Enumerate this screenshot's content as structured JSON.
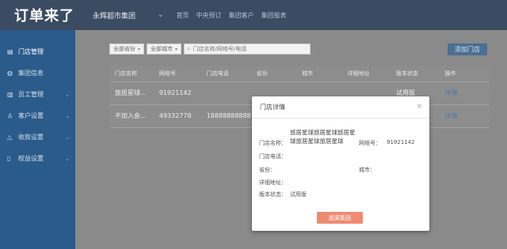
{
  "header": {
    "logo": "订单来了",
    "group": "永辉超市集团",
    "nav": [
      "首页",
      "中央预订",
      "集团客户",
      "集团报表"
    ]
  },
  "sidebar": {
    "items": [
      {
        "label": "门店管理",
        "icon": "store-icon",
        "glyph": "▤",
        "has_arrow": false
      },
      {
        "label": "集团信息",
        "icon": "globe-icon",
        "glyph": "◍",
        "has_arrow": false
      },
      {
        "label": "员工管理",
        "icon": "staff-icon",
        "glyph": "▥",
        "has_arrow": true
      },
      {
        "label": "客户设置",
        "icon": "user-icon",
        "glyph": "♙",
        "has_arrow": true
      },
      {
        "label": "收款设置",
        "icon": "warning-icon",
        "glyph": "△",
        "has_arrow": true
      },
      {
        "label": "权益设置",
        "icon": "document-icon",
        "glyph": "▯",
        "has_arrow": true
      }
    ]
  },
  "filters": {
    "province": "全部省份",
    "city": "全部城市",
    "search_placeholder": "门店名称/网络号/电话"
  },
  "add_button": "添加门店",
  "table": {
    "headers": [
      "门店名称",
      "网络号",
      "门店电话",
      "省份",
      "城市",
      "详细地址",
      "版本状态",
      "操作"
    ],
    "rows": [
      [
        "旅居星球...",
        "91921142",
        "",
        "",
        "",
        "",
        "试用版",
        "详情"
      ],
      [
        "不加入会...",
        "49332778",
        "18888888888",
        "",
        "",
        "",
        "试用版",
        "详情"
      ]
    ]
  },
  "modal": {
    "title": "门店详情",
    "close": "×",
    "name_label": "门店名称：",
    "name_value": "旅居星球旅居星球旅居星球旅居星球旅居星球",
    "network_label": "网络号：",
    "network_value": "91921142",
    "phone_label": "门店电话：",
    "phone_value": "",
    "province_label": "省份：",
    "province_value": "",
    "city_label": "城市：",
    "city_value": "",
    "address_label": "详细地址：",
    "address_value": "",
    "version_label": "版本状态：",
    "version_value": "试用版",
    "leave_button": "脱离集团"
  },
  "colors": {
    "topbar": "#3b4b62",
    "sidebar": "#2b5b8a",
    "danger": "#ee8b72",
    "link": "#4d7aa8"
  }
}
